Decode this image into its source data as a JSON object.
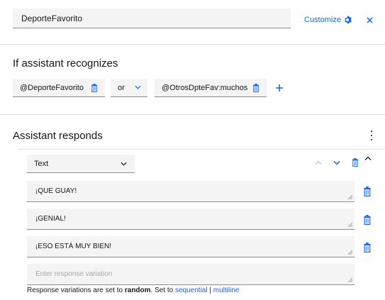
{
  "node": {
    "name_value": "DeporteFavorito",
    "customize_label": "Customize"
  },
  "condition": {
    "title": "If assistant recognizes",
    "first": "@DeporteFavorito",
    "operator": "or",
    "second": "@OtrosDpteFav:muchos"
  },
  "responses": {
    "title": "Assistant responds",
    "type_selected": "Text",
    "items": [
      {
        "text": "¡QUE GUAY!"
      },
      {
        "text": "¡GENIAL!"
      },
      {
        "text": "¡ESO ESTÁ MUY BIEN!"
      }
    ],
    "placeholder": "Enter response variation",
    "footer": {
      "prefix": "Response variations are set to",
      "mode": "random",
      "mid": ". Set to",
      "link_sequential": "sequential",
      "separator": "|",
      "link_multiline": "multiline"
    }
  },
  "colors": {
    "accent": "#0f62fe",
    "field_bg": "#f4f4f4",
    "light_accent": "#a6c8ff"
  }
}
